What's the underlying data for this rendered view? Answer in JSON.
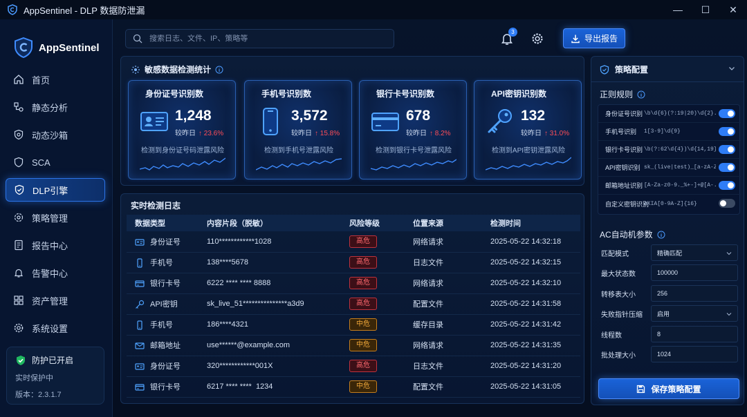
{
  "window": {
    "title": "AppSentinel - DLP 数据防泄漏",
    "controls": [
      "—",
      "☐",
      "✕"
    ]
  },
  "sidebar": {
    "brand": "AppSentinel",
    "items": [
      {
        "label": "首页",
        "icon": "home-icon"
      },
      {
        "label": "静态分析",
        "icon": "static-analysis-icon"
      },
      {
        "label": "动态沙箱",
        "icon": "sandbox-shield-icon"
      },
      {
        "label": "SCA",
        "icon": "sca-shield-icon"
      },
      {
        "label": "DLP引擎",
        "icon": "dlp-shield-icon",
        "active": true
      },
      {
        "label": "策略管理",
        "icon": "policy-gear-icon"
      },
      {
        "label": "报告中心",
        "icon": "report-icon"
      },
      {
        "label": "告警中心",
        "icon": "alert-bell-icon"
      },
      {
        "label": "资产管理",
        "icon": "asset-grid-icon"
      },
      {
        "label": "系统设置",
        "icon": "settings-gear-icon"
      }
    ],
    "protection": {
      "title": "防护已开启",
      "status": "实时保护中",
      "version": "版本：2.3.1.7"
    }
  },
  "topbar": {
    "search_placeholder": "搜索日志、文件、IP、策略等",
    "notification_count": "3",
    "export_label": "导出报告"
  },
  "stats": {
    "title": "敏感数据检测统计",
    "cards": [
      {
        "title": "身份证号识别数",
        "value": "1,248",
        "compare_label": "较昨日",
        "change": "↑ 23.6%",
        "desc": "检测到身份证号码泄露风险",
        "icon": "id-card-icon"
      },
      {
        "title": "手机号识别数",
        "value": "3,572",
        "compare_label": "较昨日",
        "change": "↑ 15.8%",
        "desc": "检测到手机号泄露风险",
        "icon": "mobile-phone-icon"
      },
      {
        "title": "银行卡号识别数",
        "value": "678",
        "compare_label": "较昨日",
        "change": "↑ 8.2%",
        "desc": "检测到银行卡号泄露风险",
        "icon": "bank-card-icon"
      },
      {
        "title": "API密钥识别数",
        "value": "132",
        "compare_label": "较昨日",
        "change": "↑ 31.0%",
        "desc": "检测到API密钥泄露风险",
        "icon": "api-key-icon"
      }
    ]
  },
  "logs": {
    "title": "实时检测日志",
    "columns": [
      "数据类型",
      "内容片段（脱敏）",
      "风险等级",
      "位置来源",
      "检测时间"
    ],
    "rows": [
      {
        "type": "身份证号",
        "icon": "id-card-icon",
        "content": "110************1028",
        "risk": "高危",
        "level": "high",
        "source": "网络请求",
        "time": "2025-05-22 14:32:18"
      },
      {
        "type": "手机号",
        "icon": "mobile-phone-icon",
        "content": "138****5678",
        "risk": "高危",
        "level": "high",
        "source": "日志文件",
        "time": "2025-05-22 14:32:15"
      },
      {
        "type": "银行卡号",
        "icon": "bank-card-icon",
        "content": "6222 **** **** 8888",
        "risk": "高危",
        "level": "high",
        "source": "网络请求",
        "time": "2025-05-22 14:32:10"
      },
      {
        "type": "API密钥",
        "icon": "api-key-icon",
        "content": "sk_live_51***************a3d9",
        "risk": "高危",
        "level": "high",
        "source": "配置文件",
        "time": "2025-05-22 14:31:58"
      },
      {
        "type": "手机号",
        "icon": "mobile-phone-icon",
        "content": "186****4321",
        "risk": "中危",
        "level": "mid",
        "source": "缓存目录",
        "time": "2025-05-22 14:31:42"
      },
      {
        "type": "邮箱地址",
        "icon": "email-icon",
        "content": "use******@example.com",
        "risk": "中危",
        "level": "mid",
        "source": "网络请求",
        "time": "2025-05-22 14:31:35"
      },
      {
        "type": "身份证号",
        "icon": "id-card-icon",
        "content": "320************001X",
        "risk": "高危",
        "level": "high",
        "source": "日志文件",
        "time": "2025-05-22 14:31:20"
      },
      {
        "type": "银行卡号",
        "icon": "bank-card-icon",
        "content": "6217 **** ****  1234",
        "risk": "中危",
        "level": "mid",
        "source": "配置文件",
        "time": "2025-05-22 14:31:05"
      }
    ]
  },
  "policy": {
    "title": "策略配置",
    "regex_title": "正则规则",
    "rules": [
      {
        "label": "身份证号识别",
        "pattern": "\\b\\d{6}(?:19|20)\\d{2}...",
        "enabled": true
      },
      {
        "label": "手机号识别",
        "pattern": "1[3-9]\\d{9}",
        "enabled": true
      },
      {
        "label": "银行卡号识别",
        "pattern": "\\b(?:62\\d{4})\\d{14,19}...",
        "enabled": true
      },
      {
        "label": "API密钥识别",
        "pattern": "sk_(live|test)_[a-zA-Z0-9]{20,}",
        "enabled": true
      },
      {
        "label": "邮箱地址识别",
        "pattern": "[A-Za-z0-9._%+-]+@[A-...",
        "enabled": true
      },
      {
        "label": "自定义密钥识别",
        "pattern": "AKIA[0-9A-Z]{16}",
        "enabled": false
      }
    ],
    "ac_title": "AC自动机参数",
    "params": [
      {
        "label": "匹配模式",
        "value": "精确匹配",
        "dropdown": true
      },
      {
        "label": "最大状态数",
        "value": "100000",
        "dropdown": false
      },
      {
        "label": "转移表大小",
        "value": "256",
        "dropdown": false
      },
      {
        "label": "失败指针压缩",
        "value": "启用",
        "dropdown": true
      },
      {
        "label": "线程数",
        "value": "8",
        "dropdown": false
      },
      {
        "label": "批处理大小",
        "value": "1024",
        "dropdown": false
      }
    ],
    "save_label": "保存策略配置"
  },
  "colors": {
    "accent": "#2f7df6",
    "risk_high": "#ff6a6f",
    "risk_mid": "#f3a93a",
    "change_up": "#ff4d57"
  }
}
